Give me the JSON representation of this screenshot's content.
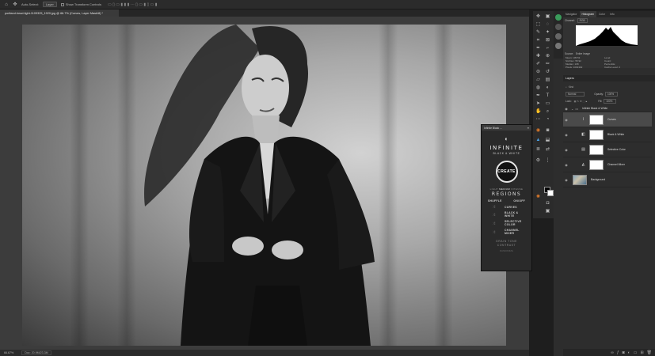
{
  "option_bar": {
    "auto_select_label": "Auto-Select:",
    "layer_select": "Layer",
    "show_transform_label": "Show Transform Controls"
  },
  "document": {
    "tab_title": "portland-head-light-1109325_1920.jpg @ 66.7% (Curves, Layer Mask/8) *"
  },
  "status_bar": {
    "zoom": "66.67%",
    "doc_size": "Doc: 20.9M/23.3M"
  },
  "plugin": {
    "header_title": "Infinite Black ...",
    "brand": "INFINITE",
    "subtitle": "BLACK & WHITE",
    "create_label": "CREATE",
    "modes": [
      "LIGHT",
      "MEDIUM",
      "INTENSE"
    ],
    "selected_mode": "MEDIUM",
    "regions_label": "REGIONS",
    "shuffle_label": "SHUFFLE",
    "onoff_label": "ON/OFF",
    "options": [
      {
        "label": "CURVES"
      },
      {
        "label": "BLACK & WHITE"
      },
      {
        "label": "SELECTIVE COLOR"
      },
      {
        "label": "CHANNEL MIXER"
      }
    ],
    "grain_label": "GRAIN TONE CONTRAST",
    "footer": "RANDOMIZE"
  },
  "histogram": {
    "tabs": [
      "Navigator",
      "Histogram",
      "Color",
      "Info"
    ],
    "active_tab": "Histogram",
    "channel_label": "Channel:",
    "channel_value": "RGB",
    "source_label": "Source:",
    "source_value": "Entire Image",
    "stats_left": [
      "Mean: 105.53",
      "Std Dev: 55.92",
      "Median: 108",
      "Pixels: 1064392"
    ],
    "stats_right": [
      "Level:",
      "Count:",
      "Percentile:",
      "Cache Level: 2"
    ]
  },
  "layers": {
    "title": "Layers",
    "kind_placeholder": "Kind",
    "blend_mode": "Normal",
    "opacity_label": "Opacity:",
    "opacity_value": "100%",
    "lock_label": "Lock:",
    "fill_label": "Fill:",
    "fill_value": "100%",
    "group_name": "Infinite Black & White",
    "items": [
      {
        "name": "Curves",
        "icon": "curves-icon"
      },
      {
        "name": "Black & White",
        "icon": "bw-icon"
      },
      {
        "name": "Selective Color",
        "icon": "selective-color-icon"
      },
      {
        "name": "Channel Mixer",
        "icon": "channel-mixer-icon"
      }
    ],
    "background_name": "Background"
  },
  "colors": {
    "panel": "#2d2d2d",
    "canvas_bg": "#3c3c3c",
    "selected_layer": "#4a4a4a"
  }
}
